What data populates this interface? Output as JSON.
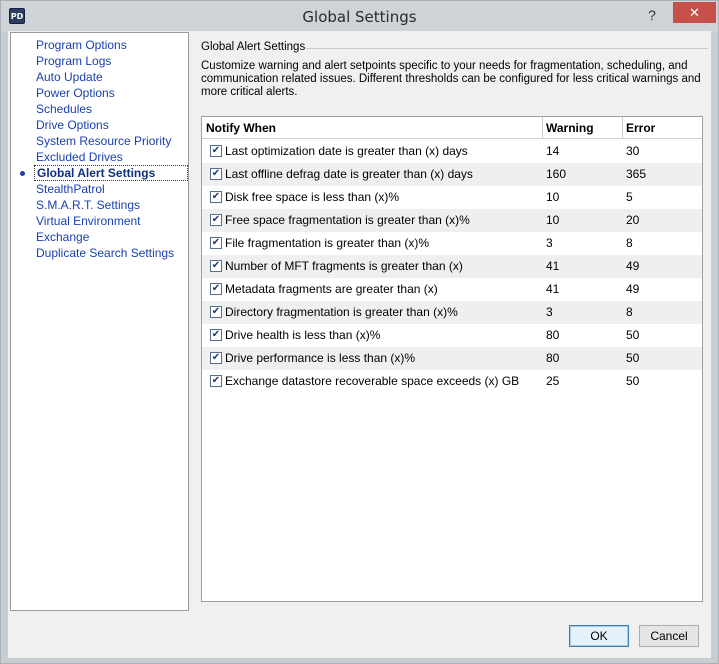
{
  "window": {
    "title": "Global Settings",
    "app_icon_text": "PD",
    "help_label": "?",
    "close_label": "✕"
  },
  "nav": {
    "items": [
      {
        "label": "Program Options"
      },
      {
        "label": "Program Logs"
      },
      {
        "label": "Auto Update"
      },
      {
        "label": "Power Options"
      },
      {
        "label": "Schedules"
      },
      {
        "label": "Drive Options"
      },
      {
        "label": "System Resource Priority"
      },
      {
        "label": "Excluded Drives"
      },
      {
        "label": "Global Alert Settings",
        "active": true
      },
      {
        "label": "StealthPatrol"
      },
      {
        "label": "S.M.A.R.T. Settings"
      },
      {
        "label": "Virtual Environment"
      },
      {
        "label": "Exchange"
      },
      {
        "label": "Duplicate Search Settings"
      }
    ]
  },
  "main": {
    "group_title": "Global Alert Settings",
    "description": "Customize warning and alert setpoints specific to your needs for fragmentation, scheduling, and communication related issues.  Different thresholds can be configured for less critical warnings and more critical alerts.",
    "table": {
      "headers": [
        "Notify When",
        "Warning",
        "Error"
      ],
      "rows": [
        {
          "checked": true,
          "label": "Last optimization date is greater than (x) days",
          "warning": "14",
          "error": "30"
        },
        {
          "checked": true,
          "label": "Last offline defrag date is greater than (x) days",
          "warning": "160",
          "error": "365"
        },
        {
          "checked": true,
          "label": "Disk free space is less than (x)%",
          "warning": "10",
          "error": "5"
        },
        {
          "checked": true,
          "label": "Free space fragmentation is greater than (x)%",
          "warning": "10",
          "error": "20"
        },
        {
          "checked": true,
          "label": "File fragmentation is greater than (x)%",
          "warning": "3",
          "error": "8"
        },
        {
          "checked": true,
          "label": "Number of MFT fragments is greater than (x)",
          "warning": "41",
          "error": "49"
        },
        {
          "checked": true,
          "label": "Metadata fragments are greater than (x)",
          "warning": "41",
          "error": "49"
        },
        {
          "checked": true,
          "label": "Directory fragmentation is greater than (x)%",
          "warning": "3",
          "error": "8"
        },
        {
          "checked": true,
          "label": "Drive health is less than (x)%",
          "warning": "80",
          "error": "50"
        },
        {
          "checked": true,
          "label": "Drive performance is less than (x)%",
          "warning": "80",
          "error": "50"
        },
        {
          "checked": true,
          "label": "Exchange datastore recoverable space exceeds (x) GB",
          "warning": "25",
          "error": "50"
        }
      ]
    }
  },
  "buttons": {
    "ok_label": "OK",
    "cancel_label": "Cancel"
  }
}
